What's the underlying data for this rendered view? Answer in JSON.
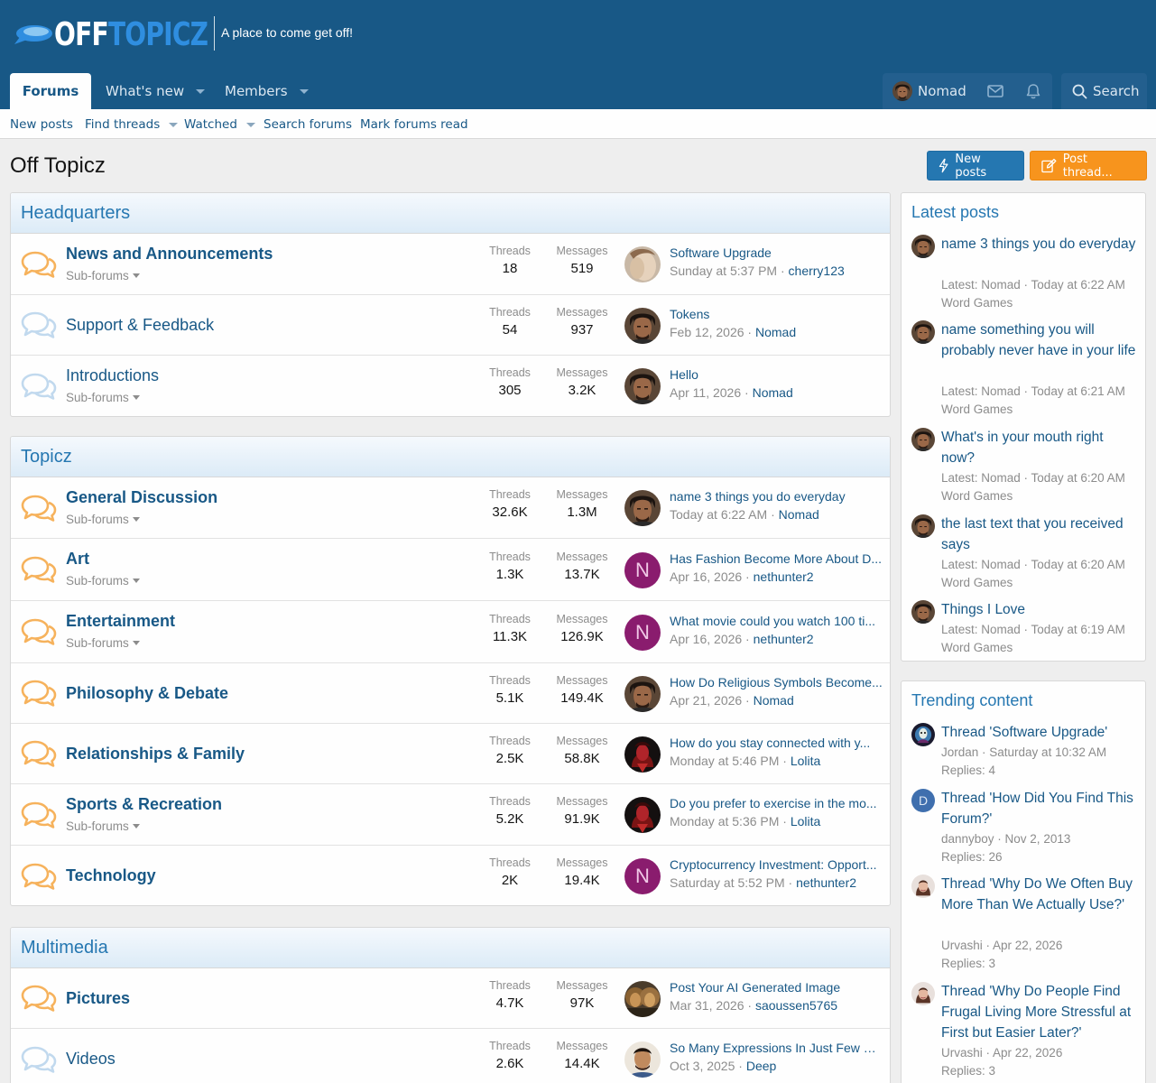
{
  "site": {
    "logo_part1": "OFF",
    "logo_part2": "TOPICZ",
    "tagline": "A place to come get off!"
  },
  "nav": {
    "tabs": [
      {
        "label": "Forums",
        "active": true
      },
      {
        "label": "What's new"
      },
      {
        "label": "Members"
      }
    ],
    "username": "Nomad",
    "search_label": "Search"
  },
  "subnav": [
    "New posts",
    "Find threads",
    "Watched",
    "Search forums",
    "Mark forums read"
  ],
  "page": {
    "title": "Off Topicz",
    "new_posts_button": "New posts",
    "post_thread_button": "Post thread..."
  },
  "labels": {
    "threads": "Threads",
    "messages": "Messages",
    "sub_forums": "Sub-forums"
  },
  "categories": [
    {
      "title": "Headquarters",
      "forums": [
        {
          "title": "News and Announcements",
          "bold": true,
          "subforums": true,
          "threads": "18",
          "messages": "519",
          "last_title": "Software Upgrade",
          "last_date": "Sunday at 5:37 PM",
          "last_user": "cherry123",
          "avatar": "cherry"
        },
        {
          "title": "Support & Feedback",
          "bold": false,
          "subforums": false,
          "threads": "54",
          "messages": "937",
          "last_title": "Tokens",
          "last_date": "Feb 12, 2026",
          "last_user": "Nomad",
          "avatar": "nomad"
        },
        {
          "title": "Introductions",
          "bold": false,
          "subforums": true,
          "threads": "305",
          "messages": "3.2K",
          "last_title": "Hello",
          "last_date": "Apr 11, 2026",
          "last_user": "Nomad",
          "avatar": "nomad"
        }
      ]
    },
    {
      "title": "Topicz",
      "forums": [
        {
          "title": "General Discussion",
          "bold": true,
          "subforums": true,
          "threads": "32.6K",
          "messages": "1.3M",
          "last_title": "name 3 things you do everyday",
          "last_date": "Today at 6:22 AM",
          "last_user": "Nomad",
          "avatar": "nomad"
        },
        {
          "title": "Art",
          "bold": true,
          "subforums": true,
          "threads": "1.3K",
          "messages": "13.7K",
          "last_title": "Has Fashion Become More About D...",
          "last_date": "Apr 16, 2026",
          "last_user": "nethunter2",
          "avatar": "N"
        },
        {
          "title": "Entertainment",
          "bold": true,
          "subforums": true,
          "threads": "11.3K",
          "messages": "126.9K",
          "last_title": "What movie could you watch 100 ti...",
          "last_date": "Apr 16, 2026",
          "last_user": "nethunter2",
          "avatar": "N"
        },
        {
          "title": "Philosophy & Debate",
          "bold": true,
          "subforums": false,
          "threads": "5.1K",
          "messages": "149.4K",
          "last_title": "How Do Religious Symbols Become...",
          "last_date": "Apr 21, 2026",
          "last_user": "Nomad",
          "avatar": "nomad"
        },
        {
          "title": "Relationships & Family",
          "bold": true,
          "subforums": false,
          "threads": "2.5K",
          "messages": "58.8K",
          "last_title": "How do you stay connected with y...",
          "last_date": "Monday at 5:46 PM",
          "last_user": "Lolita",
          "avatar": "lolita"
        },
        {
          "title": "Sports & Recreation",
          "bold": true,
          "subforums": true,
          "threads": "5.2K",
          "messages": "91.9K",
          "last_title": "Do you prefer to exercise in the mo...",
          "last_date": "Monday at 5:36 PM",
          "last_user": "Lolita",
          "avatar": "lolita"
        },
        {
          "title": "Technology",
          "bold": true,
          "subforums": false,
          "threads": "2K",
          "messages": "19.4K",
          "last_title": "Cryptocurrency Investment: Opport...",
          "last_date": "Saturday at 5:52 PM",
          "last_user": "nethunter2",
          "avatar": "N"
        }
      ]
    },
    {
      "title": "Multimedia",
      "forums": [
        {
          "title": "Pictures",
          "bold": true,
          "subforums": false,
          "threads": "4.7K",
          "messages": "97K",
          "last_title": "Post Your AI Generated Image",
          "last_date": "Mar 31, 2026",
          "last_user": "saoussen5765",
          "avatar": "lion"
        },
        {
          "title": "Videos",
          "bold": false,
          "subforums": false,
          "threads": "2.6K",
          "messages": "14.4K",
          "last_title": "So Many Expressions In Just Few Se...",
          "last_date": "Oct 3, 2025",
          "last_user": "Deep",
          "avatar": "deep"
        }
      ]
    }
  ],
  "latest_posts": {
    "title": "Latest posts",
    "items": [
      {
        "title": "name 3 things you do everyday",
        "meta": "Latest: Nomad · Today at 6:22 AM",
        "forum": "Word Games"
      },
      {
        "title": "name something you will probably never have in your life",
        "meta": "Latest: Nomad · Today at 6:21 AM",
        "forum": "Word Games"
      },
      {
        "title": "What's in your mouth right now?",
        "meta": "Latest: Nomad · Today at 6:20 AM",
        "forum": "Word Games"
      },
      {
        "title": "the last text that you received says",
        "meta": "Latest: Nomad · Today at 6:20 AM",
        "forum": "Word Games"
      },
      {
        "title": "Things I Love",
        "meta": "Latest: Nomad · Today at 6:19 AM",
        "forum": "Word Games"
      }
    ]
  },
  "trending": {
    "title": "Trending content",
    "items": [
      {
        "title": "Thread 'Software Upgrade'",
        "meta": "Jordan · Saturday at 10:32 AM",
        "replies": "Replies: 4",
        "avatar": "jordan"
      },
      {
        "title": "Thread 'How Did You Find This Forum?'",
        "meta": "dannyboy · Nov 2, 2013",
        "replies": "Replies: 26",
        "avatar": "D"
      },
      {
        "title": "Thread 'Why Do We Often Buy More Than We Actually Use?'",
        "meta": "Urvashi · Apr 22, 2026",
        "replies": "Replies: 3",
        "avatar": "urvashi"
      },
      {
        "title": "Thread 'Why Do People Find Frugal Living More Stressful at First but Easier Later?'",
        "meta": "Urvashi · Apr 22, 2026",
        "replies": "Replies: 3",
        "avatar": "urvashi"
      }
    ]
  },
  "colors": {
    "header_bg": "#185886",
    "link": "#185886",
    "accent_orange": "#f7941d",
    "button_blue": "#2577b1"
  }
}
